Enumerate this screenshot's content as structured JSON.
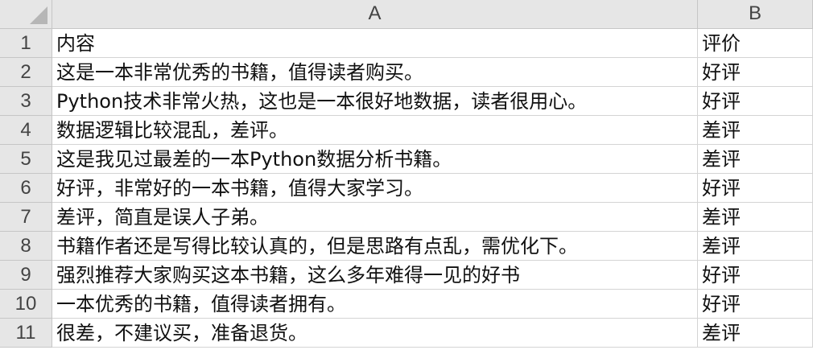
{
  "columns": {
    "a": "A",
    "b": "B"
  },
  "rows": [
    {
      "num": "1",
      "a": "内容",
      "b": "评价"
    },
    {
      "num": "2",
      "a": "这是一本非常优秀的书籍，值得读者购买。",
      "b": "好评"
    },
    {
      "num": "3",
      "a": "Python技术非常火热，这也是一本很好地数据，读者很用心。",
      "b": "好评"
    },
    {
      "num": "4",
      "a": "数据逻辑比较混乱，差评。",
      "b": "差评"
    },
    {
      "num": "5",
      "a": "这是我见过最差的一本Python数据分析书籍。",
      "b": "差评"
    },
    {
      "num": "6",
      "a": "好评，非常好的一本书籍，值得大家学习。",
      "b": "好评"
    },
    {
      "num": "7",
      "a": "差评，简直是误人子弟。",
      "b": "差评"
    },
    {
      "num": "8",
      "a": "书籍作者还是写得比较认真的，但是思路有点乱，需优化下。",
      "b": "差评"
    },
    {
      "num": "9",
      "a": "强烈推荐大家购买这本书籍，这么多年难得一见的好书",
      "b": "好评"
    },
    {
      "num": "10",
      "a": "一本优秀的书籍，值得读者拥有。",
      "b": "好评"
    },
    {
      "num": "11",
      "a": "很差，不建议买，准备退货。",
      "b": "差评"
    }
  ]
}
